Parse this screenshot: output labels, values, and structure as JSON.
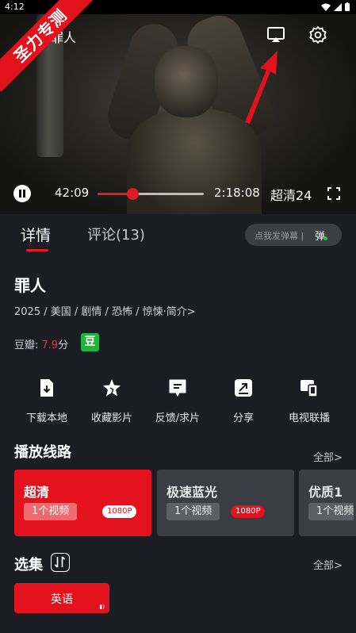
{
  "status_bar": {
    "time": "4:12"
  },
  "watermark": {
    "text": "圣力专测"
  },
  "player": {
    "title": "罪人",
    "current_time": "42:09",
    "duration": "2:18:08",
    "progress_fraction": 0.33,
    "quality": "超清24"
  },
  "tabs": [
    {
      "label": "详情",
      "active": true
    },
    {
      "label": "评论(13)",
      "active": false
    }
  ],
  "danmaku": {
    "placeholder": "点我发弹幕 |",
    "icon_text": "弹"
  },
  "movie": {
    "title": "罪人",
    "meta": "2025 / 美国 / 剧情 / 恐怖 / 惊悚·简介>",
    "douban_label": "豆瓣:",
    "douban_score": "7.9",
    "douban_unit": "分",
    "douban_badge": "豆"
  },
  "actions": [
    {
      "label": "下载本地",
      "icon": "download-icon"
    },
    {
      "label": "收藏影片",
      "icon": "star-icon"
    },
    {
      "label": "反馈/求片",
      "icon": "feedback-icon"
    },
    {
      "label": "分享",
      "icon": "share-icon"
    },
    {
      "label": "电视联播",
      "icon": "tv-cast-icon"
    }
  ],
  "routes_section": {
    "title": "播放线路",
    "more": "全部>",
    "routes": [
      {
        "name": "超清",
        "count": "1个视频",
        "badge": "1080P",
        "active": true
      },
      {
        "name": "极速蓝光",
        "count": "1个视频",
        "badge": "1080P",
        "active": false
      },
      {
        "name": "优质1",
        "count": "1个视频",
        "badge": "",
        "active": false
      }
    ]
  },
  "episodes_section": {
    "title": "选集",
    "more": "全部>",
    "episodes": [
      {
        "label": "英语",
        "playing": true
      }
    ]
  },
  "colors": {
    "accent": "#e3121c",
    "background": "#1b1c24",
    "douban_green": "#20b53a"
  }
}
